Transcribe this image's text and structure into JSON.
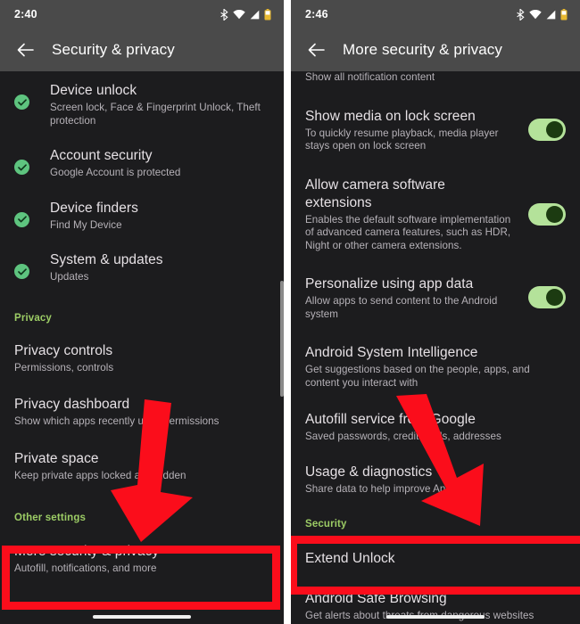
{
  "accent": {
    "red_highlight": "#fb0d1b",
    "green_check": "#5ec47f",
    "section_green": "#9ccc65",
    "toggle_track": "#b4e29a",
    "toggle_knob": "#1c3b11",
    "battery_yellow": "#e8b931"
  },
  "left_panel": {
    "status": {
      "time": "2:40",
      "icons": [
        "bluetooth-icon",
        "wifi-icon",
        "cellular-signal-icon",
        "battery-icon"
      ]
    },
    "appbar": {
      "back_label": "Back",
      "title": "Security & privacy"
    },
    "items": [
      {
        "icon": "check-circle-icon",
        "title": "Device unlock",
        "sub": "Screen lock, Face & Fingerprint Unlock, Theft protection"
      },
      {
        "icon": "check-circle-icon",
        "title": "Account security",
        "sub": "Google Account is protected"
      },
      {
        "icon": "check-circle-icon",
        "title": "Device finders",
        "sub": "Find My Device"
      },
      {
        "icon": "check-circle-icon",
        "title": "System & updates",
        "sub": "Updates"
      }
    ],
    "section_privacy": "Privacy",
    "privacy_items": [
      {
        "title": "Privacy controls",
        "sub": "Permissions, controls"
      },
      {
        "title": "Privacy dashboard",
        "sub": "Show which apps recently used permissions"
      },
      {
        "title": "Private space",
        "sub": "Keep private apps locked and hidden"
      }
    ],
    "section_other": "Other settings",
    "highlighted_item": {
      "title": "More security & privacy",
      "sub": "Autofill, notifications, and more"
    }
  },
  "right_panel": {
    "status": {
      "time": "2:46",
      "icons": [
        "bluetooth-icon",
        "wifi-icon",
        "cellular-signal-icon",
        "battery-icon"
      ]
    },
    "appbar": {
      "back_label": "Back",
      "title": "More security & privacy"
    },
    "partial_top_item": {
      "sub": "Show all notification content"
    },
    "items": [
      {
        "title": "Show media on lock screen",
        "sub": "To quickly resume playback, media player stays open on lock screen",
        "toggle": true
      },
      {
        "title": "Allow camera software extensions",
        "sub": "Enables the default software implementation of advanced camera features, such as HDR, Night or other camera extensions.",
        "toggle": true
      },
      {
        "title": "Personalize using app data",
        "sub": "Allow apps to send content to the Android system",
        "toggle": true
      },
      {
        "title": "Android System Intelligence",
        "sub": "Get suggestions based on the people, apps, and content you interact with",
        "toggle": false
      },
      {
        "title": "Autofill service from Google",
        "sub": "Saved passwords, credit cards, addresses",
        "toggle": false
      },
      {
        "title": "Usage & diagnostics",
        "sub": "Share data to help improve Android",
        "toggle": false
      }
    ],
    "section_security": "Security",
    "highlighted_item": {
      "title": "Extend Unlock"
    },
    "bottom_item": {
      "title": "Android Safe Browsing",
      "sub": "Get alerts about threats from dangerous websites"
    }
  },
  "annotations": {
    "left_arrow": "down-arrow-annotation",
    "right_arrow": "down-right-arrow-annotation",
    "left_box": "highlight-box-more-security-privacy",
    "right_box": "highlight-box-extend-unlock"
  }
}
